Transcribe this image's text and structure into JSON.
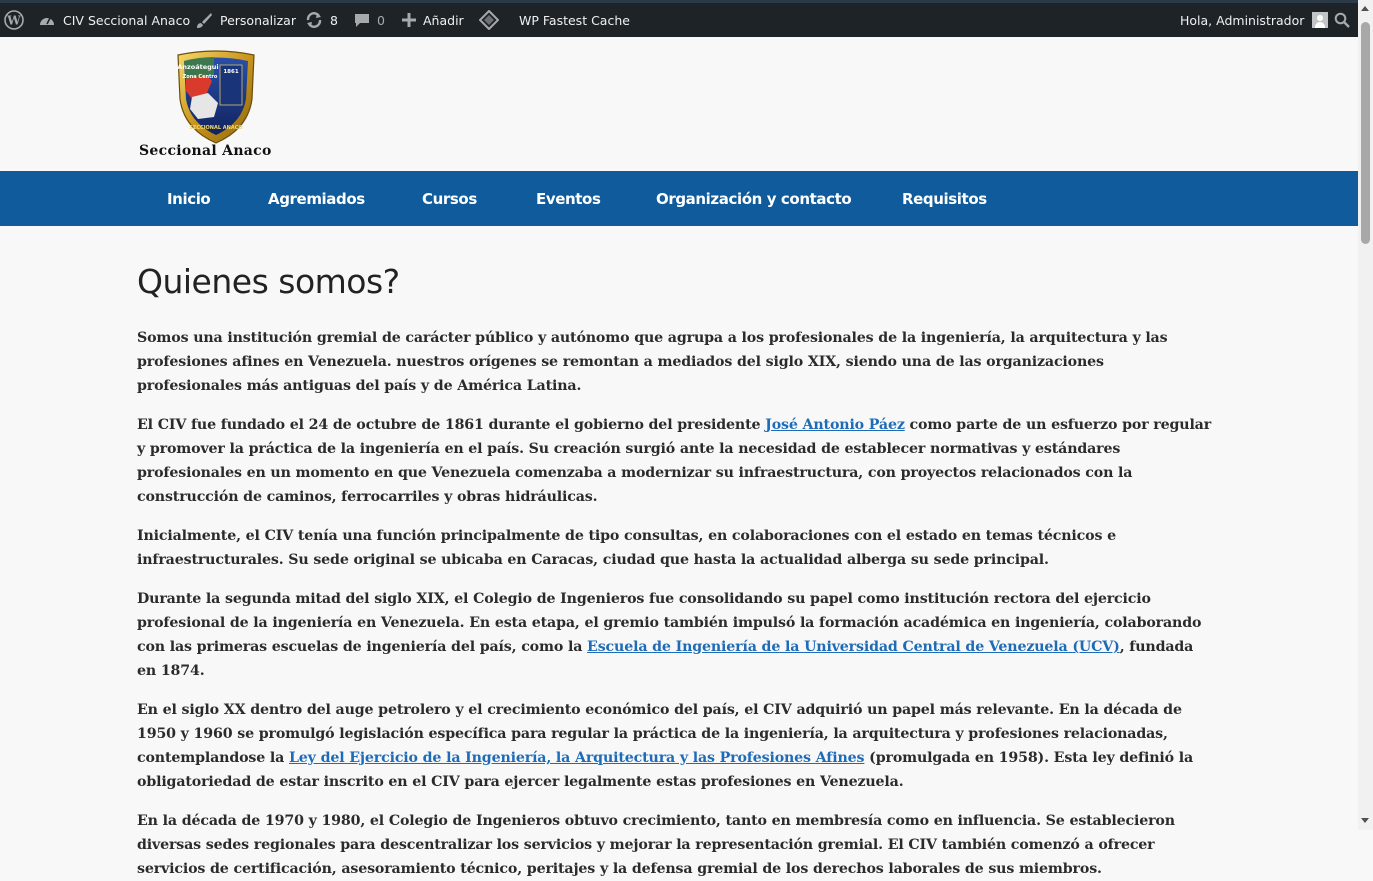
{
  "admin_bar": {
    "site_name": "CIV Seccional Anaco",
    "customize": "Personalizar",
    "updates_count": "8",
    "comments_count": "0",
    "add_new": "Añadir",
    "cache_plugin": "WP Fastest Cache",
    "greeting": "Hola, Administrador"
  },
  "header": {
    "logo_name": "Seccional Anaco",
    "logo_badge_top": "Anzoátegui",
    "logo_badge_mid": "Zona Centro",
    "logo_badge_year": "1861",
    "logo_badge_bottom": "SECCIONAL ANACO"
  },
  "nav": {
    "items": [
      "Inicio",
      "Agremiados",
      "Cursos",
      "Eventos",
      "Organización y contacto",
      "Requisitos"
    ]
  },
  "content": {
    "title": "Quienes somos?",
    "p1": "Somos una institución gremial de carácter público y autónomo que agrupa a los profesionales de la ingeniería, la arquitectura y las profesiones afines en Venezuela. nuestros orígenes se remontan a mediados del siglo XIX, siendo una de las organizaciones profesionales más antiguas del país y de América Latina.",
    "p2_before": "El CIV fue fundado el 24 de octubre de 1861 durante el gobierno del presidente ",
    "p2_link": "José Antonio Páez",
    "p2_after": " como parte de un esfuerzo por regular y promover la práctica de la ingeniería en el país. Su creación surgió ante la necesidad de establecer normativas y estándares profesionales en un momento en que Venezuela comenzaba a modernizar su infraestructura, con proyectos relacionados con la construcción de caminos, ferrocarriles y obras hidráulicas.",
    "p3": "Inicialmente, el CIV tenía una función principalmente de tipo consultas, en colaboraciones con el estado en temas técnicos e infraestructurales. Su sede original se ubicaba en Caracas, ciudad que hasta la actualidad alberga su sede principal.",
    "p4_before": "Durante la segunda mitad del siglo XIX, el Colegio de Ingenieros fue consolidando su papel como institución rectora del ejercicio profesional de la ingeniería en Venezuela. En esta etapa, el gremio también impulsó la formación académica en ingeniería, colaborando con las primeras escuelas de ingeniería del país, como la ",
    "p4_link": "Escuela de Ingeniería de la Universidad Central de Venezuela (UCV)",
    "p4_after": ", fundada en 1874.",
    "p5_before": "En el siglo XX dentro del auge petrolero y el crecimiento económico del país, el CIV adquirió un papel más relevante. En la década de 1950 y 1960 se promulgó legislación específica para regular la práctica de la ingeniería, la arquitectura y profesiones relacionadas, contemplandose la ",
    "p5_link": "Ley del Ejercicio de la Ingeniería, la Arquitectura y las Profesiones Afines",
    "p5_after": " (promulgada en 1958). Esta ley definió la obligatoriedad de estar inscrito en el CIV para ejercer legalmente estas profesiones en Venezuela.",
    "p6": "En la década de 1970 y 1980, el Colegio de Ingenieros obtuvo crecimiento, tanto en membresía como en influencia. Se establecieron diversas sedes regionales para descentralizar los servicios y mejorar la representación gremial. El CIV también comenzó a ofrecer servicios de certificación, asesoramiento técnico, peritajes y la defensa gremial de los derechos laborales de sus miembros."
  },
  "colors": {
    "admin_bar": "#1d2327",
    "nav_bar": "#0f5b9c",
    "link": "#1e6bb8",
    "background": "#f8f8f8"
  }
}
